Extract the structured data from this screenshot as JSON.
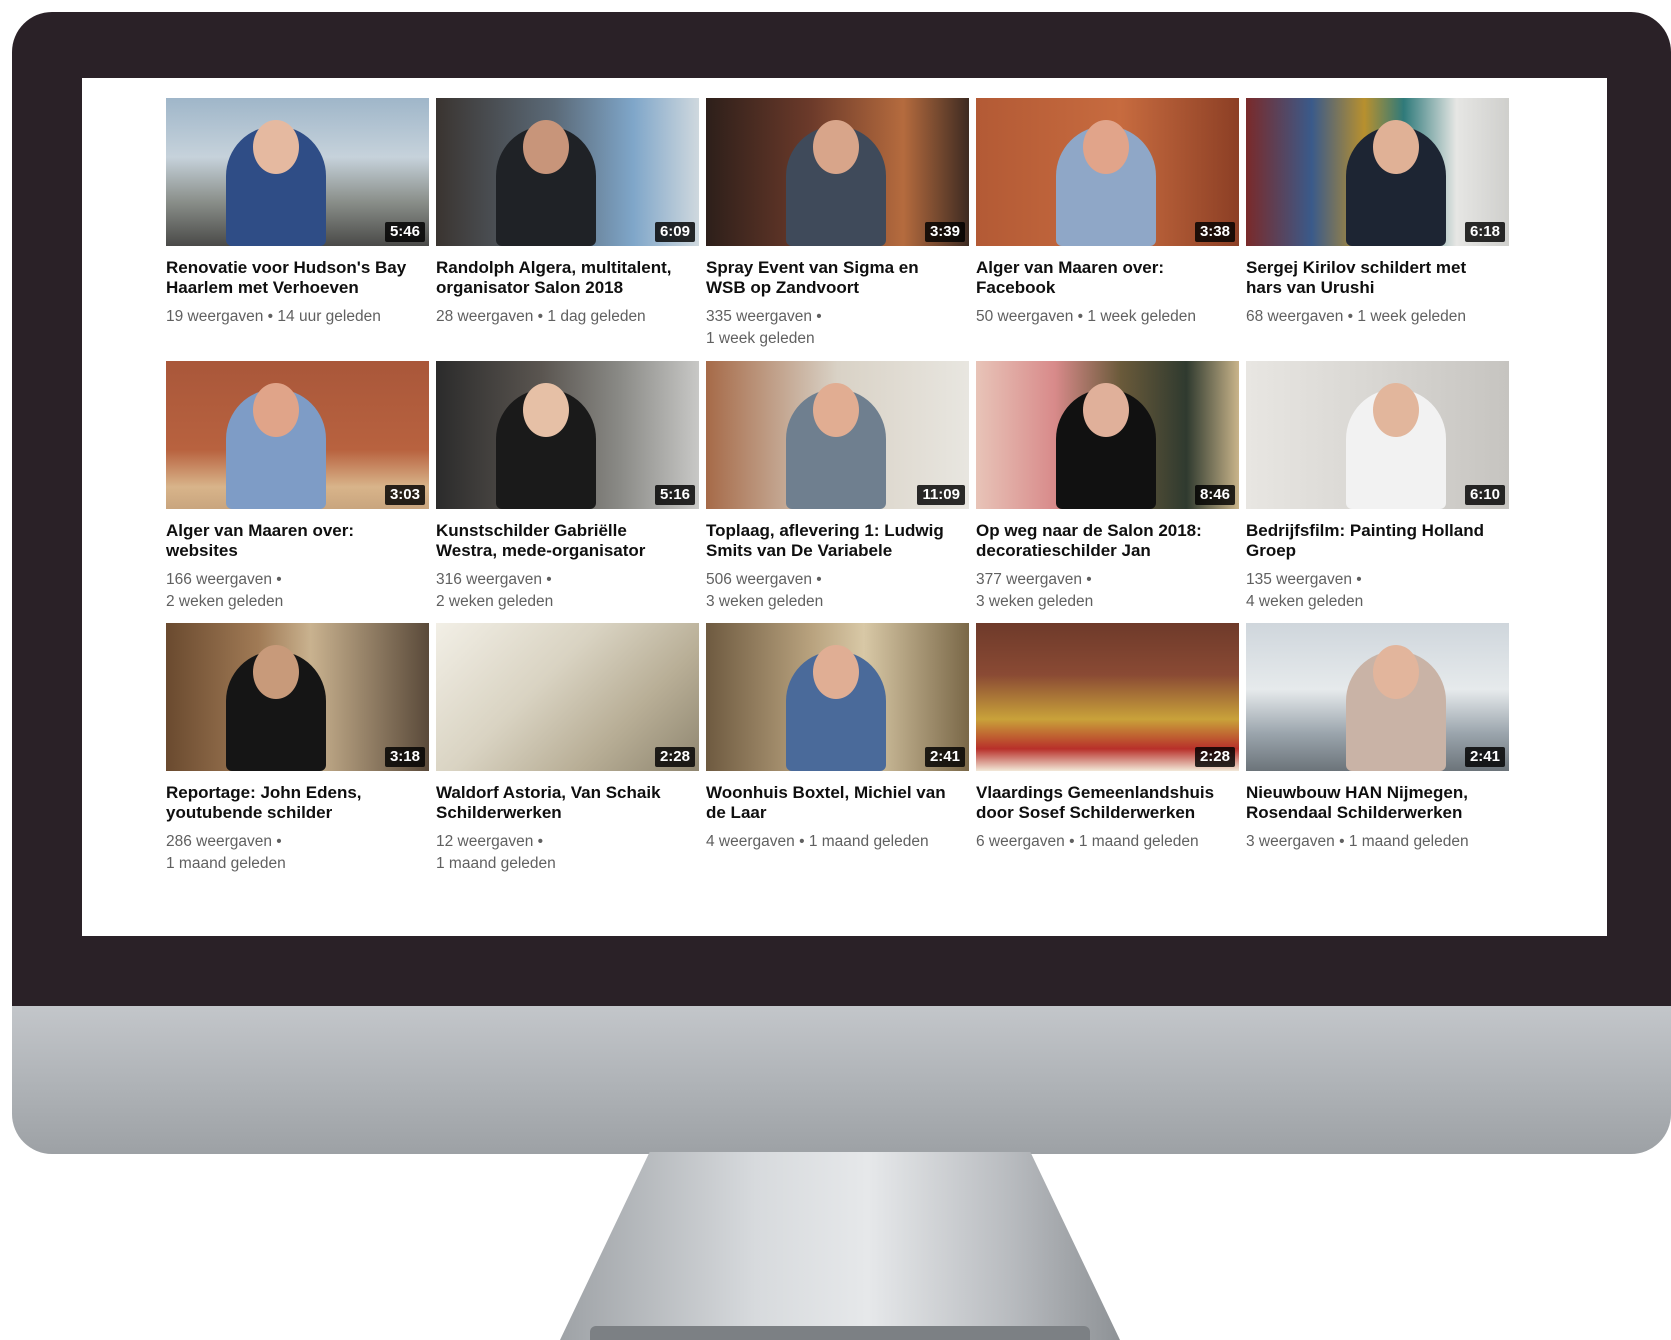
{
  "videos": [
    {
      "title": "Renovatie voor Hudson's Bay Haarlem met Verhoeven",
      "duration": "5:46",
      "views": "19 weergaven",
      "age": "14 uur geleden",
      "wrap": false,
      "thumb": {
        "bg": "linear-gradient(180deg,#9fb6c9 0%,#c6d2db 40%,#8a8f8a 70%,#4a4a48 100%)",
        "person": "#2f4d86",
        "head": "#e5b9a0"
      }
    },
    {
      "title": "Randolph Algera, multitalent, organisator Salon 2018",
      "duration": "6:09",
      "views": "28 weergaven",
      "age": "1 dag geleden",
      "wrap": false,
      "thumb": {
        "bg": "linear-gradient(90deg,#3a3430 0%,#5b6a78 45%,#7fa6c9 75%,#cfd8de 100%)",
        "person": "#1f2226",
        "head": "#c8957a"
      }
    },
    {
      "title": "Spray Event van Sigma en WSB op Zandvoort",
      "duration": "3:39",
      "views": "335 weergaven",
      "age": "1 week geleden",
      "wrap": true,
      "thumb": {
        "bg": "linear-gradient(90deg,#2d1f1a 0%,#6c3a2a 40%,#b56b3e 75%,#3e2b22 100%)",
        "person": "#3f4a5a",
        "head": "#d8a58a"
      }
    },
    {
      "title": "Alger van Maaren over: Facebook",
      "duration": "3:38",
      "views": "50 weergaven",
      "age": "1 week geleden",
      "wrap": false,
      "thumb": {
        "bg": "linear-gradient(90deg,#b35a35 0%,#c76b3f 55%,#8c3f25 100%)",
        "person": "#8fa7c7",
        "head": "#e1a48a"
      }
    },
    {
      "title": "Sergej Kirilov schildert met hars van Urushi",
      "duration": "6:18",
      "views": "68 weergaven",
      "age": "1 week geleden",
      "wrap": false,
      "thumb": {
        "bg": "linear-gradient(90deg,#7a2a2a 0%,#3a5a8a 25%,#b8902e 45%,#2f7a7a 60%,#e6e6e4 80%,#cfcfcc 100%)",
        "person": "#1d2533",
        "head": "#e0b196"
      }
    },
    {
      "title": "Alger van Maaren over: websites",
      "duration": "3:03",
      "views": "166 weergaven",
      "age": "2 weken geleden",
      "wrap": true,
      "thumb": {
        "bg": "linear-gradient(180deg,#a9573a 0%,#b8623f 60%,#d8b48a 85%,#c9a57e 100%)",
        "person": "#7e9cc6",
        "head": "#e0a489"
      }
    },
    {
      "title": "Kunstschilder Gabriëlle Westra, mede-organisator",
      "duration": "5:16",
      "views": "316 weergaven",
      "age": "2 weken geleden",
      "wrap": true,
      "thumb": {
        "bg": "linear-gradient(90deg,#2b2b2b 0%,#5a5550 40%,#8a8a86 70%,#c8c8c6 100%)",
        "person": "#1a1a1a",
        "head": "#e6c0a6"
      }
    },
    {
      "title": "Toplaag, aflevering 1: Ludwig Smits van De Variabele",
      "duration": "11:09",
      "views": "506 weergaven",
      "age": "3 weken geleden",
      "wrap": true,
      "thumb": {
        "bg": "linear-gradient(90deg,#a66a48 0%,#d9d2c6 50%,#e8e6e0 100%)",
        "person": "#6f7f8f",
        "head": "#e1ad92"
      }
    },
    {
      "title": "Op weg naar de Salon 2018: decoratieschilder Jan",
      "duration": "8:46",
      "views": "377 weergaven",
      "age": "3 weken geleden",
      "wrap": true,
      "thumb": {
        "bg": "linear-gradient(90deg,#e8c4b8 0%,#d88a8a 30%,#6a5a3a 55%,#2f3a2f 80%,#c9b48a 100%)",
        "person": "#111111",
        "head": "#e0b09a"
      }
    },
    {
      "title": "Bedrijfsfilm: Painting Holland Groep",
      "duration": "6:10",
      "views": "135 weergaven",
      "age": "4 weken geleden",
      "wrap": true,
      "thumb": {
        "bg": "linear-gradient(90deg,#e8e6e2 0%,#d8d6d2 50%,#c6c4c0 100%)",
        "person": "#f2f2f2",
        "head": "#e2b69c"
      }
    },
    {
      "title": "Reportage: John Edens, youtubende schilder",
      "duration": "3:18",
      "views": "286 weergaven",
      "age": "1 maand geleden",
      "wrap": true,
      "thumb": {
        "bg": "linear-gradient(90deg,#6a4a2f 0%,#a07a55 35%,#c9b28f 55%,#5a4a3a 100%)",
        "person": "#151515",
        "head": "#c89a7a"
      }
    },
    {
      "title": "Waldorf Astoria, Van Schaik Schilderwerken",
      "duration": "2:28",
      "views": "12 weergaven",
      "age": "1 maand geleden",
      "wrap": true,
      "thumb": {
        "bg": "linear-gradient(135deg,#f2efe6 0%,#d9d3c2 40%,#b8ae96 70%,#8f8670 100%)",
        "person": "",
        "head": ""
      }
    },
    {
      "title": "Woonhuis Boxtel, Michiel van de Laar",
      "duration": "2:41",
      "views": "4 weergaven",
      "age": "1 maand geleden",
      "wrap": false,
      "thumb": {
        "bg": "linear-gradient(90deg,#6e5a40 0%,#b8a27e 40%,#d8c8a6 60%,#7a6848 100%)",
        "person": "#4a6a9a",
        "head": "#e0ae94"
      }
    },
    {
      "title": "Vlaardings Gemeenlandshuis door Sosef Schilderwerken",
      "duration": "2:28",
      "views": "6 weergaven",
      "age": "1 maand geleden",
      "wrap": false,
      "thumb": {
        "bg": "linear-gradient(180deg,#6e3a2a 0%,#8a4a34 35%,#c9a23a 65%,#b8302a 85%,#f2e8d8 100%)",
        "person": "",
        "head": ""
      }
    },
    {
      "title": "Nieuwbouw HAN Nijmegen, Rosendaal Schilderwerken",
      "duration": "2:41",
      "views": "3 weergaven",
      "age": "1 maand geleden",
      "wrap": false,
      "thumb": {
        "bg": "linear-gradient(180deg,#cfd6dc 0%,#e6eaec 45%,#9aa4ac 75%,#6c747a 100%)",
        "person": "#c9b3a6",
        "head": "#e2b59c"
      }
    }
  ]
}
